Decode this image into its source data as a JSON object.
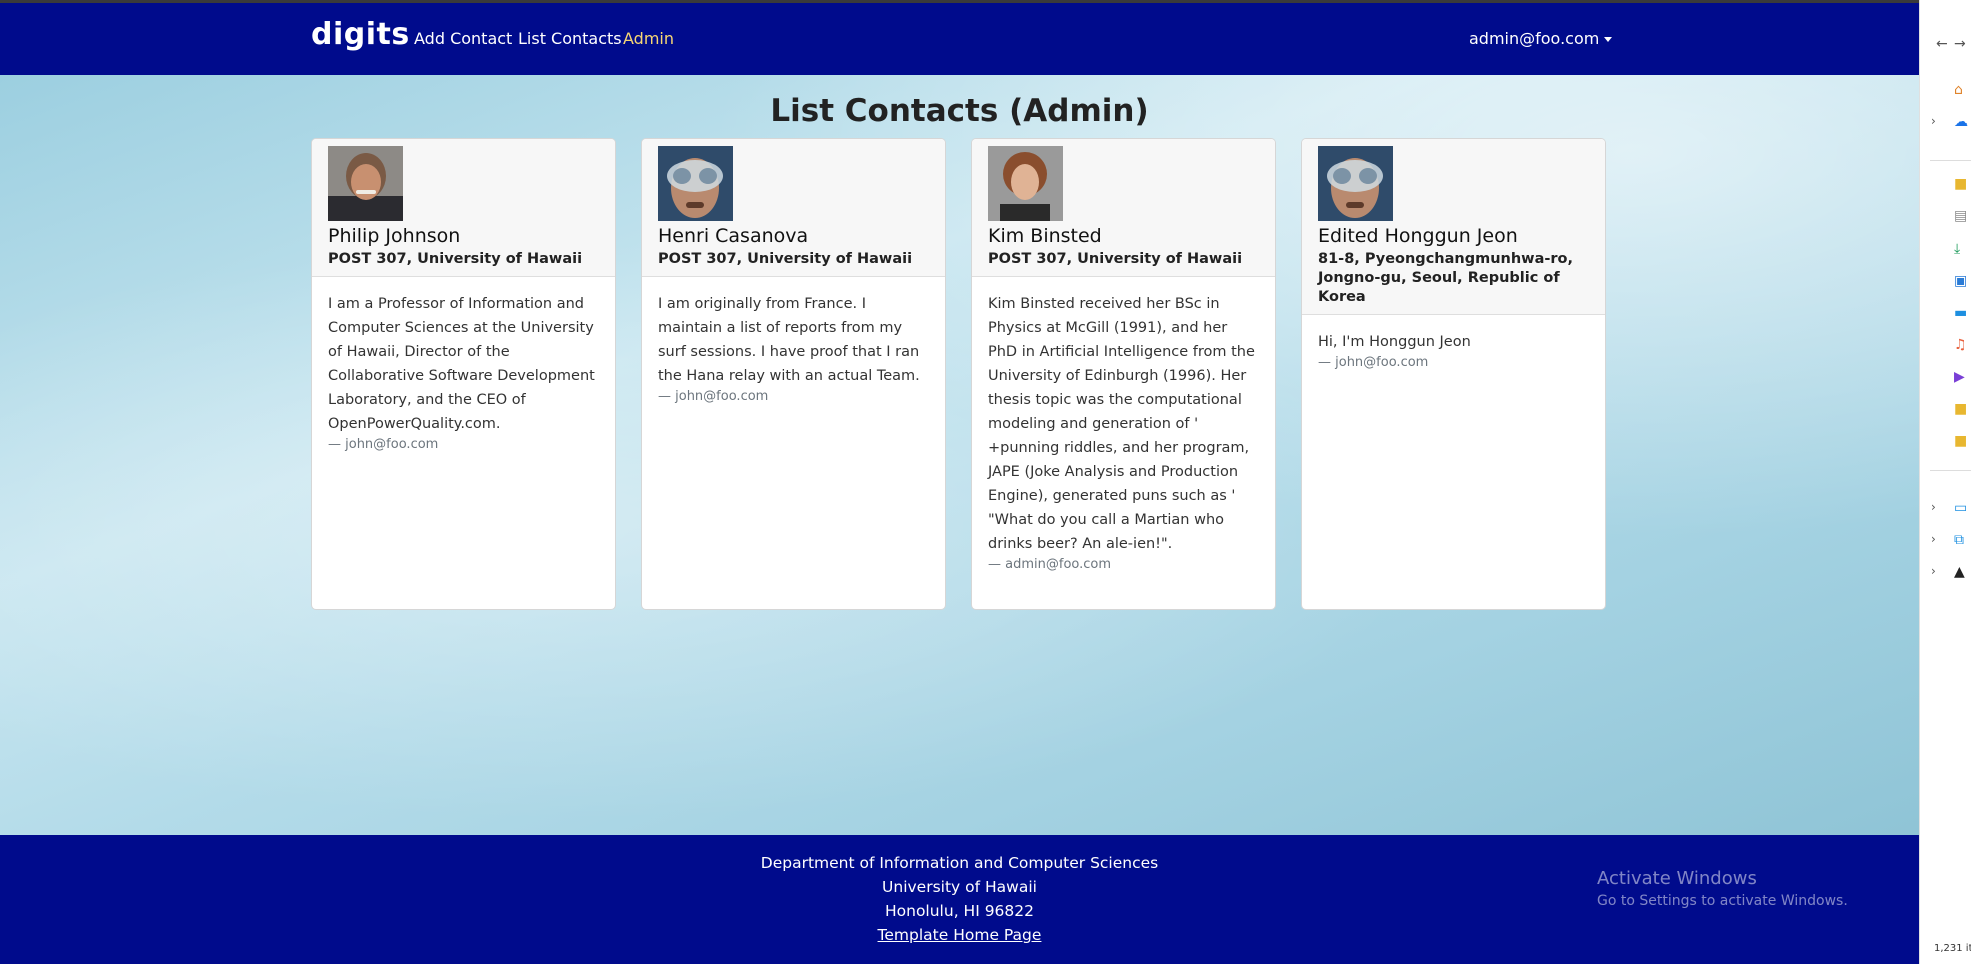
{
  "navbar": {
    "brand": "digits",
    "links": [
      "Add Contact",
      "List Contacts",
      "Admin"
    ],
    "user": "admin@foo.com",
    "color": "#000b8c",
    "active_color": "#f7d774"
  },
  "page": {
    "title": "List Contacts (Admin)"
  },
  "contacts": [
    {
      "name": "Philip Johnson",
      "address": "POST 307, University of Hawaii",
      "description": "I am a Professor of Information and Computer Sciences at the University of Hawaii, Director of the Collaborative Software Development Laboratory, and the CEO of OpenPowerQuality.com.",
      "owner": "— john@foo.com"
    },
    {
      "name": "Henri Casanova",
      "address": "POST 307, University of Hawaii",
      "description": "I am originally from France. I maintain a list of reports from my surf sessions. I have proof that I ran the Hana relay with an actual Team.",
      "owner": "— john@foo.com"
    },
    {
      "name": "Kim Binsted",
      "address": "POST 307, University of Hawaii",
      "description": "Kim Binsted received her BSc in Physics at McGill (1991), and her PhD in Artificial Intelligence from the University of Edinburgh (1996). Her thesis topic was the computational modeling and generation of ' +punning riddles, and her program, JAPE (Joke Analysis and Production Engine), generated puns such as ' \"What do you call a Martian who drinks beer? An ale-ien!\".",
      "owner": "— admin@foo.com"
    },
    {
      "name": "Edited Honggun Jeon",
      "address": "81-8, Pyeongchangmunhwa-ro, Jongno-gu, Seoul, Republic of Korea",
      "description": "Hi, I'm Honggun Jeon",
      "owner": "— john@foo.com"
    }
  ],
  "footer": {
    "line1": "Department of Information and Computer Sciences",
    "line2": "University of Hawaii",
    "line3": "Honolulu, HI 96822",
    "link": "Template Home Page"
  },
  "watermark": {
    "title": "Activate Windows",
    "subtitle": "Go to Settings to activate Windows."
  },
  "side_panel": {
    "item_count": "1,231 it"
  }
}
